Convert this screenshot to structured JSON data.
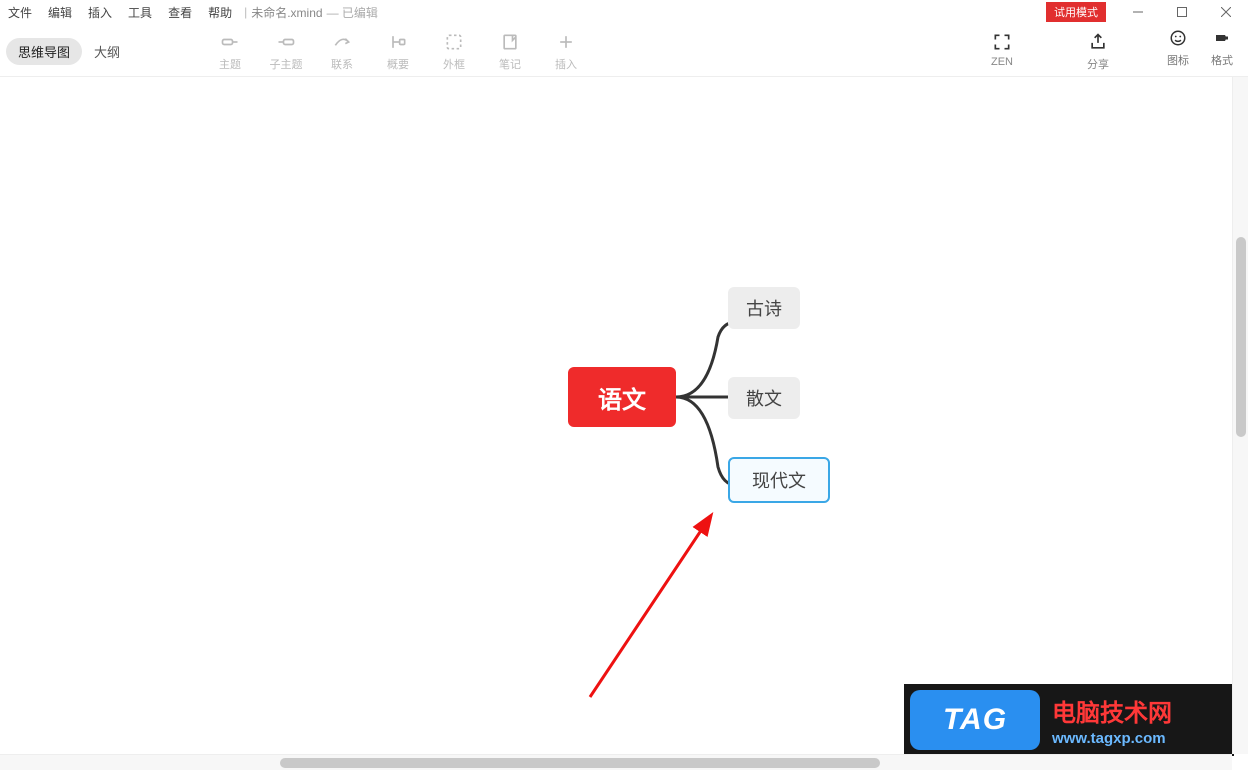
{
  "menu": {
    "file": "文件",
    "edit": "编辑",
    "insert": "插入",
    "tools": "工具",
    "view": "查看",
    "help": "帮助"
  },
  "doc": {
    "title": "未命名.xmind",
    "edited": "— 已编辑"
  },
  "titlebar": {
    "trial_badge": "试用模式"
  },
  "view_tabs": {
    "mindmap": "思维导图",
    "outline": "大纲"
  },
  "tools": {
    "topic": "主题",
    "subtopic": "子主题",
    "relationship": "联系",
    "summary": "概要",
    "boundary": "外框",
    "note": "笔记",
    "insert": "插入"
  },
  "right_tools": {
    "zen": "ZEN",
    "share": "分享",
    "icons": "图标",
    "format": "格式"
  },
  "mindmap": {
    "central": "语文",
    "children": [
      "古诗",
      "散文",
      "现代文"
    ]
  },
  "watermark": {
    "tag": "TAG",
    "line1": "电脑技术网",
    "line2": "www.tagxp.com"
  }
}
